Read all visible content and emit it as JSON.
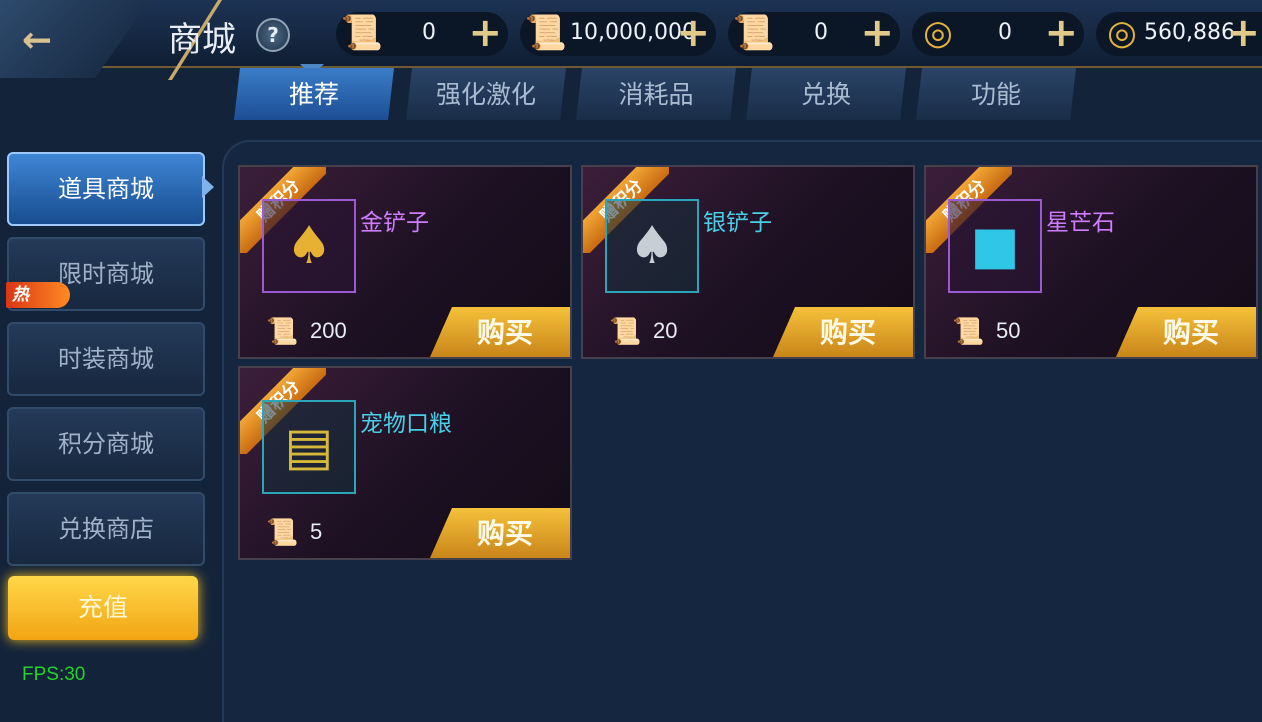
{
  "header": {
    "title": "商城",
    "help_label": "?",
    "currencies": [
      {
        "icon": "red-scroll-icon",
        "value": "0"
      },
      {
        "icon": "gold-scroll-icon",
        "value": "10,000,000"
      },
      {
        "icon": "locked-scroll-icon",
        "value": "0"
      },
      {
        "icon": "gold-coin-icon",
        "value": "0"
      },
      {
        "icon": "locked-coin-icon",
        "value": "560,886"
      }
    ],
    "plus_label": "+"
  },
  "tabs": [
    {
      "label": "推荐",
      "active": true
    },
    {
      "label": "强化激化",
      "active": false
    },
    {
      "label": "消耗品",
      "active": false
    },
    {
      "label": "兑换",
      "active": false
    },
    {
      "label": "功能",
      "active": false
    }
  ],
  "sidebar": {
    "items": [
      {
        "label": "道具商城",
        "active": true
      },
      {
        "label": "限时商城",
        "active": false
      },
      {
        "label": "时装商城",
        "active": false
      },
      {
        "label": "积分商城",
        "active": false
      },
      {
        "label": "兑换商店",
        "active": false
      }
    ],
    "hot_badge": "热",
    "recharge_label": "充值"
  },
  "fps": "FPS:30",
  "items": [
    {
      "badge": "赠积分",
      "name": "金铲子",
      "icon": "gold-shovel-icon",
      "price": "200",
      "buy": "购买"
    },
    {
      "badge": "赠积分",
      "name": "银铲子",
      "icon": "silver-shovel-icon",
      "price": "20",
      "buy": "购买"
    },
    {
      "badge": "赠积分",
      "name": "星芒石",
      "icon": "blue-crystal-icon",
      "price": "50",
      "buy": "购买"
    },
    {
      "badge": "赠积分",
      "name": "宠物口粮",
      "icon": "pet-food-bag-icon",
      "price": "5",
      "buy": "购买"
    }
  ],
  "colors": {
    "accent_blue": "#3b7cc8",
    "gold": "#f5c13a",
    "purple_name": "#cf7cff",
    "blue_name": "#48cfe6",
    "fps_green": "#23d22a"
  }
}
